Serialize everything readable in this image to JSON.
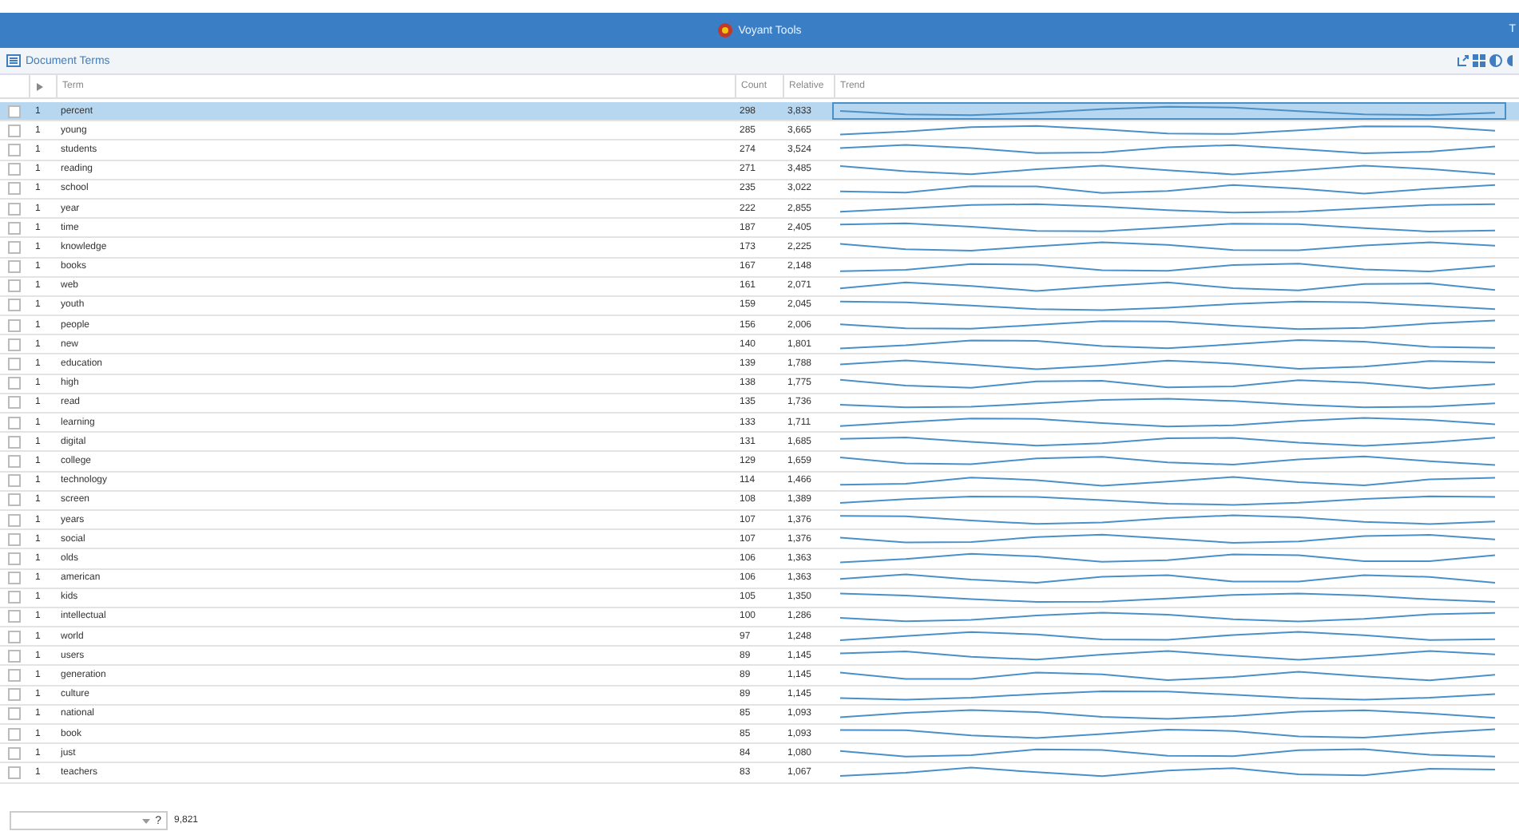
{
  "window": {
    "title": "Voyant Tools",
    "corner_text": "T"
  },
  "panel": {
    "title": "Document Terms"
  },
  "table": {
    "columns": [
      "Term",
      "Count",
      "Relative",
      "Trend"
    ],
    "rows": [
      {
        "index": "1",
        "term": "percent",
        "count": "298",
        "relative": "3,833",
        "selected": true
      },
      {
        "index": "1",
        "term": "young",
        "count": "285",
        "relative": "3,665",
        "selected": false
      },
      {
        "index": "1",
        "term": "students",
        "count": "274",
        "relative": "3,524",
        "selected": false
      },
      {
        "index": "1",
        "term": "reading",
        "count": "271",
        "relative": "3,485",
        "selected": false
      },
      {
        "index": "1",
        "term": "school",
        "count": "235",
        "relative": "3,022",
        "selected": false
      },
      {
        "index": "1",
        "term": "year",
        "count": "222",
        "relative": "2,855",
        "selected": false
      },
      {
        "index": "1",
        "term": "time",
        "count": "187",
        "relative": "2,405",
        "selected": false
      },
      {
        "index": "1",
        "term": "knowledge",
        "count": "173",
        "relative": "2,225",
        "selected": false
      },
      {
        "index": "1",
        "term": "books",
        "count": "167",
        "relative": "2,148",
        "selected": false
      },
      {
        "index": "1",
        "term": "web",
        "count": "161",
        "relative": "2,071",
        "selected": false
      },
      {
        "index": "1",
        "term": "youth",
        "count": "159",
        "relative": "2,045",
        "selected": false
      },
      {
        "index": "1",
        "term": "people",
        "count": "156",
        "relative": "2,006",
        "selected": false
      },
      {
        "index": "1",
        "term": "new",
        "count": "140",
        "relative": "1,801",
        "selected": false
      },
      {
        "index": "1",
        "term": "education",
        "count": "139",
        "relative": "1,788",
        "selected": false
      },
      {
        "index": "1",
        "term": "high",
        "count": "138",
        "relative": "1,775",
        "selected": false
      },
      {
        "index": "1",
        "term": "read",
        "count": "135",
        "relative": "1,736",
        "selected": false
      },
      {
        "index": "1",
        "term": "learning",
        "count": "133",
        "relative": "1,711",
        "selected": false
      },
      {
        "index": "1",
        "term": "digital",
        "count": "131",
        "relative": "1,685",
        "selected": false
      },
      {
        "index": "1",
        "term": "college",
        "count": "129",
        "relative": "1,659",
        "selected": false
      },
      {
        "index": "1",
        "term": "technology",
        "count": "114",
        "relative": "1,466",
        "selected": false
      },
      {
        "index": "1",
        "term": "screen",
        "count": "108",
        "relative": "1,389",
        "selected": false
      },
      {
        "index": "1",
        "term": "years",
        "count": "107",
        "relative": "1,376",
        "selected": false
      },
      {
        "index": "1",
        "term": "social",
        "count": "107",
        "relative": "1,376",
        "selected": false
      },
      {
        "index": "1",
        "term": "olds",
        "count": "106",
        "relative": "1,363",
        "selected": false
      },
      {
        "index": "1",
        "term": "american",
        "count": "106",
        "relative": "1,363",
        "selected": false
      },
      {
        "index": "1",
        "term": "kids",
        "count": "105",
        "relative": "1,350",
        "selected": false
      },
      {
        "index": "1",
        "term": "intellectual",
        "count": "100",
        "relative": "1,286",
        "selected": false
      },
      {
        "index": "1",
        "term": "world",
        "count": "97",
        "relative": "1,248",
        "selected": false
      },
      {
        "index": "1",
        "term": "users",
        "count": "89",
        "relative": "1,145",
        "selected": false
      },
      {
        "index": "1",
        "term": "generation",
        "count": "89",
        "relative": "1,145",
        "selected": false
      },
      {
        "index": "1",
        "term": "culture",
        "count": "89",
        "relative": "1,145",
        "selected": false
      },
      {
        "index": "1",
        "term": "national",
        "count": "85",
        "relative": "1,093",
        "selected": false
      },
      {
        "index": "1",
        "term": "book",
        "count": "85",
        "relative": "1,093",
        "selected": false
      },
      {
        "index": "1",
        "term": "just",
        "count": "84",
        "relative": "1,080",
        "selected": false
      },
      {
        "index": "1",
        "term": "teachers",
        "count": "83",
        "relative": "1,067",
        "selected": false
      }
    ]
  },
  "footer": {
    "help": "?",
    "total": "9,821"
  }
}
